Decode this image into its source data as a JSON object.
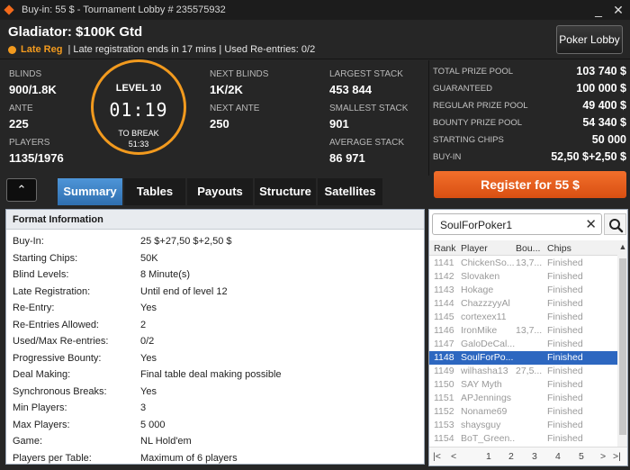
{
  "window": {
    "title": "Buy-in: 55 $ - Tournament Lobby # 235575932",
    "minimize": "_",
    "close": "✕"
  },
  "header": {
    "tournament_name": "Gladiator: $100K Gtd",
    "late_reg": "Late Reg",
    "late_info": "| Late registration ends in 17 mins | Used Re-entries: 0/2",
    "poker_lobby": "Poker Lobby"
  },
  "stats": {
    "blinds_label": "BLINDS",
    "blinds": "900/1.8K",
    "ante_label": "ANTE",
    "ante": "225",
    "players_label": "PLAYERS",
    "players": "1135/1976",
    "next_blinds_label": "NEXT BLINDS",
    "next_blinds": "1K/2K",
    "next_ante_label": "NEXT ANTE",
    "next_ante": "250",
    "largest_label": "LARGEST STACK",
    "largest": "453 844",
    "smallest_label": "SMALLEST STACK",
    "smallest": "901",
    "average_label": "AVERAGE STACK",
    "average": "86 971"
  },
  "clock": {
    "level": "LEVEL 10",
    "time": "01:19",
    "to_break": "TO BREAK",
    "break_time": "51:33",
    "ring_color": "#f29a1e"
  },
  "prize": [
    {
      "label": "TOTAL PRIZE POOL",
      "value": "103 740 $"
    },
    {
      "label": "GUARANTEED",
      "value": "100 000 $"
    },
    {
      "label": "REGULAR PRIZE POOL",
      "value": "49 400 $"
    },
    {
      "label": "BOUNTY PRIZE POOL",
      "value": "54 340 $"
    },
    {
      "label": "STARTING CHIPS",
      "value": "50 000"
    },
    {
      "label": "BUY-IN",
      "value": "52,50 $+2,50 $"
    }
  ],
  "tabs": {
    "summary": "Summary",
    "tables": "Tables",
    "payouts": "Payouts",
    "structure": "Structure",
    "satellites": "Satellites",
    "collapse": "⌃"
  },
  "register": "Register for  55 $",
  "format": {
    "title": "Format Information",
    "rows": [
      {
        "label": "Buy-In:",
        "value": "25 $+27,50 $+2,50 $"
      },
      {
        "label": "Starting Chips:",
        "value": "50K"
      },
      {
        "label": "Blind Levels:",
        "value": "8 Minute(s)"
      },
      {
        "label": "Late Registration:",
        "value": "Until end of level 12"
      },
      {
        "label": "Re-Entry:",
        "value": "Yes"
      },
      {
        "label": "Re-Entries Allowed:",
        "value": "2"
      },
      {
        "label": "Used/Max Re-entries:",
        "value": "0/2"
      },
      {
        "label": "Progressive Bounty:",
        "value": "Yes"
      },
      {
        "label": "Deal Making:",
        "value": "Final table deal making possible"
      },
      {
        "label": "Synchronous Breaks:",
        "value": "Yes"
      },
      {
        "label": "Min Players:",
        "value": "3"
      },
      {
        "label": "Max Players:",
        "value": "5 000"
      },
      {
        "label": "Game:",
        "value": "NL Hold'em"
      },
      {
        "label": "Players per Table:",
        "value": "Maximum of 6 players"
      }
    ]
  },
  "players": {
    "search_value": "SoulForPoker1",
    "clear": "✕",
    "columns": [
      "Rank",
      "Player",
      "Bou...",
      "Chips"
    ],
    "rows": [
      {
        "rank": "1141",
        "player": "ChickenSo...",
        "bounty": "13,7...",
        "chips": "Finished"
      },
      {
        "rank": "1142",
        "player": "Slovaken",
        "bounty": "",
        "chips": "Finished"
      },
      {
        "rank": "1143",
        "player": "Hokage",
        "bounty": "",
        "chips": "Finished"
      },
      {
        "rank": "1144",
        "player": "ChazzzyyAl",
        "bounty": "",
        "chips": "Finished"
      },
      {
        "rank": "1145",
        "player": "cortexex11",
        "bounty": "",
        "chips": "Finished"
      },
      {
        "rank": "1146",
        "player": "IronMike",
        "bounty": "13,7...",
        "chips": "Finished"
      },
      {
        "rank": "1147",
        "player": "GaloDeCal...",
        "bounty": "",
        "chips": "Finished"
      },
      {
        "rank": "1148",
        "player": "SoulForPo...",
        "bounty": "",
        "chips": "Finished"
      },
      {
        "rank": "1149",
        "player": "wilhasha13",
        "bounty": "27,5...",
        "chips": "Finished"
      },
      {
        "rank": "1150",
        "player": "SAY Myth",
        "bounty": "",
        "chips": "Finished"
      },
      {
        "rank": "1151",
        "player": "APJennings",
        "bounty": "",
        "chips": "Finished"
      },
      {
        "rank": "1152",
        "player": "Noname69",
        "bounty": "",
        "chips": "Finished"
      },
      {
        "rank": "1153",
        "player": "shaysguy",
        "bounty": "",
        "chips": "Finished"
      },
      {
        "rank": "1154",
        "player": "BoT_Green...",
        "bounty": "",
        "chips": "Finished"
      }
    ],
    "selected_rank": "1148",
    "pager": {
      "first": "|<",
      "prev": "<",
      "pages": [
        "1",
        "2",
        "3",
        "4",
        "5"
      ],
      "next": ">",
      "last": ">|"
    }
  }
}
